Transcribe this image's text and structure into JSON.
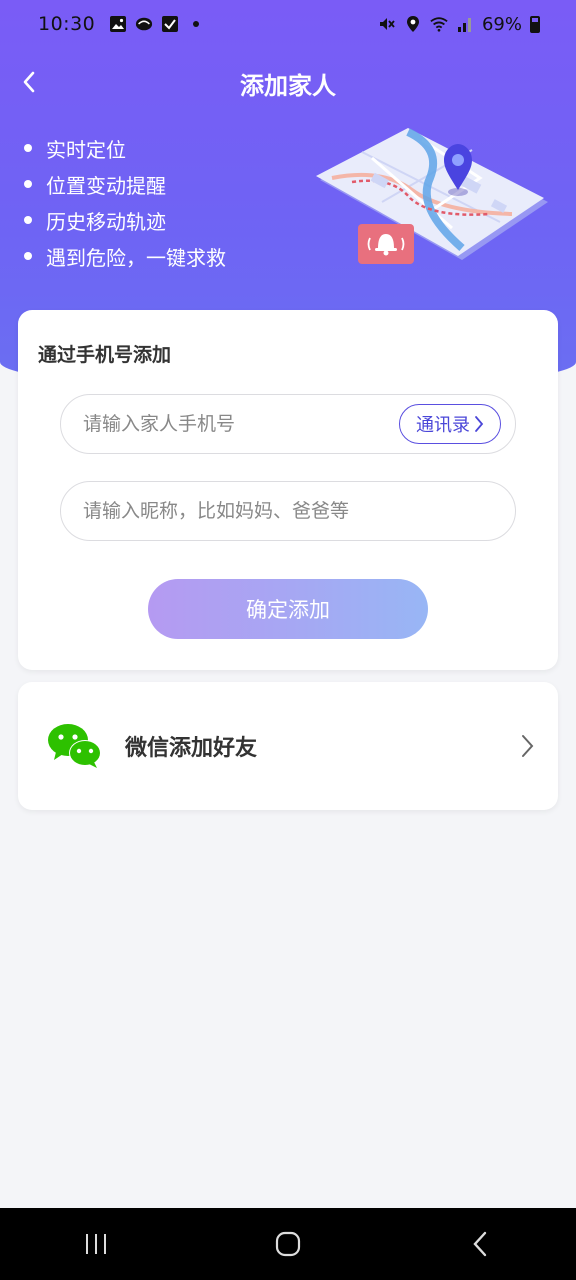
{
  "status_bar": {
    "time": "10:30",
    "battery": "69%",
    "left_icons": [
      "gallery-icon",
      "app-icon",
      "checkbox-icon",
      "dot-icon"
    ],
    "right_icons": [
      "mute-icon",
      "location-icon",
      "wifi-icon",
      "signal-icon",
      "battery-icon"
    ]
  },
  "header": {
    "title": "添加家人",
    "back_icon": "chevron-left-icon"
  },
  "features": [
    {
      "label": "实时定位"
    },
    {
      "label": "位置变动提醒"
    },
    {
      "label": "历史移动轨迹"
    },
    {
      "label": "遇到危险，一键求救"
    }
  ],
  "phone_card": {
    "title": "通过手机号添加",
    "phone_placeholder": "请输入家人手机号",
    "phone_value": "",
    "contacts_label": "通讯录",
    "nickname_placeholder": "请输入昵称，比如妈妈、爸爸等",
    "nickname_value": "",
    "confirm_label": "确定添加"
  },
  "wechat_card": {
    "label": "微信添加好友",
    "icon": "wechat-icon"
  },
  "colors": {
    "header_gradient_top": "#7a5cf6",
    "header_gradient_bottom": "#6a6ff2",
    "accent": "#4a46d8",
    "wechat_green": "#2dc100",
    "background": "#f4f5f8"
  },
  "system_nav": [
    "recent-apps-icon",
    "home-icon",
    "back-icon"
  ]
}
